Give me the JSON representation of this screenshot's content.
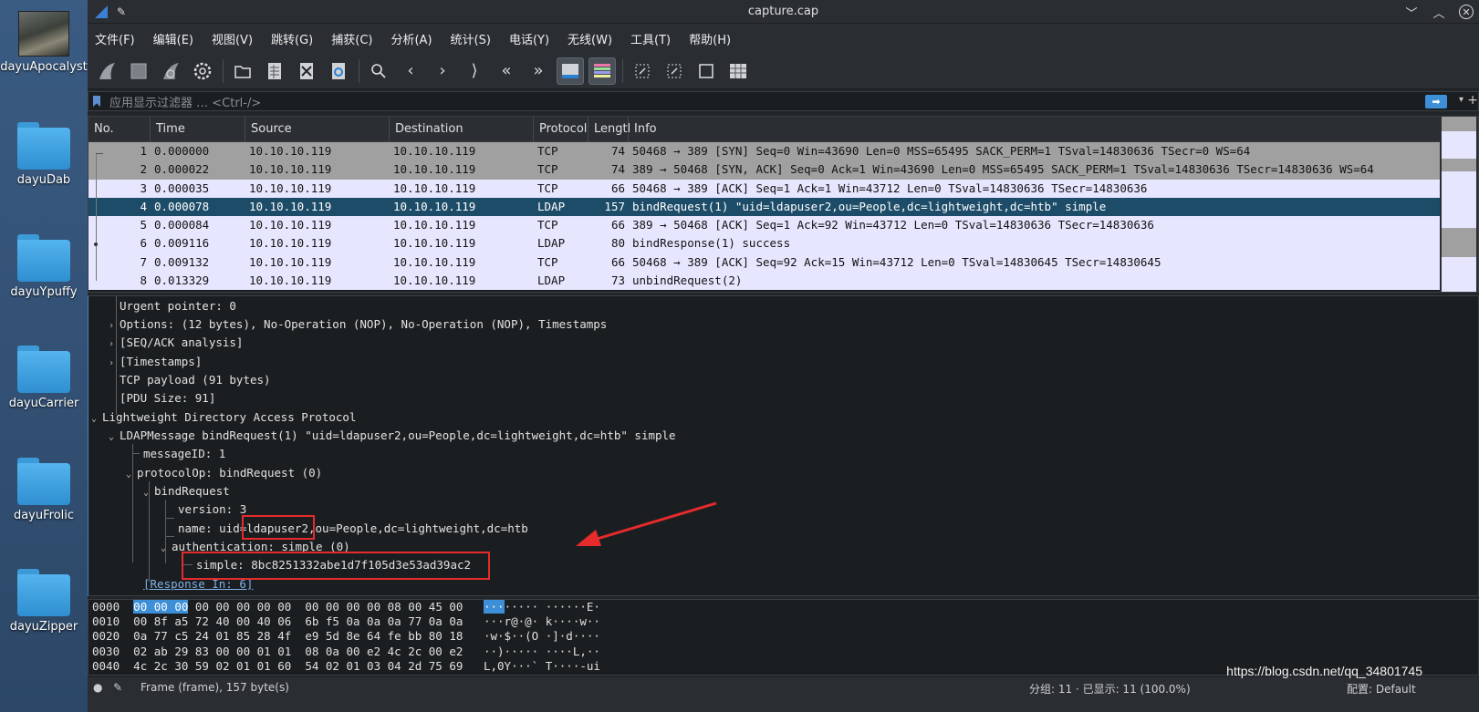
{
  "desktop": {
    "icons": [
      {
        "label": "dayuApocalyst",
        "type": "thumbnail"
      },
      {
        "label": "dayuDab",
        "type": "folder"
      },
      {
        "label": "dayuYpuffy",
        "type": "folder"
      },
      {
        "label": "dayuCarrier",
        "type": "folder"
      },
      {
        "label": "dayuFrolic",
        "type": "folder"
      },
      {
        "label": "dayuZipper",
        "type": "folder"
      }
    ]
  },
  "window": {
    "title": "capture.cap",
    "controls": {
      "minimize": "﹀",
      "maximize": "︿",
      "close": "✕"
    }
  },
  "menu": [
    "文件(F)",
    "编辑(E)",
    "视图(V)",
    "跳转(G)",
    "捕获(C)",
    "分析(A)",
    "统计(S)",
    "电话(Y)",
    "无线(W)",
    "工具(T)",
    "帮助(H)"
  ],
  "toolbar": {
    "icons": [
      "shark-fin-start-icon",
      "stop-square-icon",
      "restart-fin-icon",
      "gear-options-icon",
      "open-folder-icon",
      "file-grid-icon",
      "close-file-icon",
      "reload-file-icon",
      "search-icon",
      "back-arrow-icon",
      "forward-arrow-icon",
      "goto-arrow-icon",
      "first-packet-icon",
      "last-packet-icon",
      "autoscroll-icon",
      "colorize-icon",
      "zoom-in-icon",
      "zoom-out-icon",
      "normal-size-icon",
      "resize-columns-icon"
    ]
  },
  "filter": {
    "placeholder": "应用显示过滤器 … <Ctrl-/>",
    "apply_icon": "arrow-right-icon",
    "dropdown_icon": "chevron-down-icon",
    "add_label": "+"
  },
  "packet_list": {
    "columns": [
      "No.",
      "Time",
      "Source",
      "Destination",
      "Protocol",
      "Lengtl",
      "Info"
    ],
    "rows": [
      {
        "no": "1",
        "time": "0.000000",
        "src": "10.10.10.119",
        "dst": "10.10.10.119",
        "proto": "TCP",
        "len": "74",
        "info": "50468 → 389 [SYN] Seq=0 Win=43690 Len=0 MSS=65495 SACK_PERM=1 TSval=14830636 TSecr=0 WS=64",
        "style": "gray"
      },
      {
        "no": "2",
        "time": "0.000022",
        "src": "10.10.10.119",
        "dst": "10.10.10.119",
        "proto": "TCP",
        "len": "74",
        "info": "389 → 50468 [SYN, ACK] Seq=0 Ack=1 Win=43690 Len=0 MSS=65495 SACK_PERM=1 TSval=14830636 TSecr=14830636 WS=64",
        "style": "gray"
      },
      {
        "no": "3",
        "time": "0.000035",
        "src": "10.10.10.119",
        "dst": "10.10.10.119",
        "proto": "TCP",
        "len": "66",
        "info": "50468 → 389 [ACK] Seq=1 Ack=1 Win=43712 Len=0 TSval=14830636 TSecr=14830636",
        "style": "light"
      },
      {
        "no": "4",
        "time": "0.000078",
        "src": "10.10.10.119",
        "dst": "10.10.10.119",
        "proto": "LDAP",
        "len": "157",
        "info": "bindRequest(1) \"uid=ldapuser2,ou=People,dc=lightweight,dc=htb\" simple",
        "style": "sel"
      },
      {
        "no": "5",
        "time": "0.000084",
        "src": "10.10.10.119",
        "dst": "10.10.10.119",
        "proto": "TCP",
        "len": "66",
        "info": "389 → 50468 [ACK] Seq=1 Ack=92 Win=43712 Len=0 TSval=14830636 TSecr=14830636",
        "style": "light"
      },
      {
        "no": "6",
        "time": "0.009116",
        "src": "10.10.10.119",
        "dst": "10.10.10.119",
        "proto": "LDAP",
        "len": "80",
        "info": "bindResponse(1) success",
        "style": "light"
      },
      {
        "no": "7",
        "time": "0.009132",
        "src": "10.10.10.119",
        "dst": "10.10.10.119",
        "proto": "TCP",
        "len": "66",
        "info": "50468 → 389 [ACK] Seq=92 Ack=15 Win=43712 Len=0 TSval=14830645 TSecr=14830645",
        "style": "light"
      },
      {
        "no": "8",
        "time": "0.013329",
        "src": "10.10.10.119",
        "dst": "10.10.10.119",
        "proto": "LDAP",
        "len": "73",
        "info": "unbindRequest(2)",
        "style": "light"
      }
    ]
  },
  "detail": {
    "lines": [
      {
        "text": "Urgent pointer: 0",
        "caret": ""
      },
      {
        "text": "Options: (12 bytes), No-Operation (NOP), No-Operation (NOP), Timestamps",
        "caret": "›"
      },
      {
        "text": "[SEQ/ACK analysis]",
        "caret": "›"
      },
      {
        "text": "[Timestamps]",
        "caret": "›"
      },
      {
        "text": "TCP payload (91 bytes)",
        "caret": ""
      },
      {
        "text": "[PDU Size: 91]",
        "caret": ""
      },
      {
        "text": "Lightweight Directory Access Protocol",
        "caret": "⌄"
      },
      {
        "text": "LDAPMessage bindRequest(1) \"uid=ldapuser2,ou=People,dc=lightweight,dc=htb\" simple",
        "caret": "⌄"
      },
      {
        "text": "messageID: 1",
        "caret": ""
      },
      {
        "text": "protocolOp: bindRequest (0)",
        "caret": "⌄"
      },
      {
        "text": "bindRequest",
        "caret": "⌄"
      },
      {
        "text": "version: 3",
        "caret": ""
      },
      {
        "text": "name: uid=ldapuser2,ou=People,dc=lightweight,dc=htb",
        "caret": ""
      },
      {
        "text": "authentication: simple (0)",
        "caret": "⌄"
      },
      {
        "text": "simple: 8bc8251332abe1d7f105d3e53ad39ac2",
        "caret": ""
      },
      {
        "text": "[Response In: 6]",
        "caret": ""
      }
    ],
    "annotation_color": "#e52b2b"
  },
  "bytes": {
    "rows": [
      {
        "offset": "0000",
        "sel": "00 00 00",
        "hex": " 00 00 00 00 00  00 00 00 00 08 00 45 00",
        "ascii_sel": "···",
        "ascii": "····· ······E·"
      },
      {
        "offset": "0010",
        "sel": "",
        "hex": "00 8f a5 72 40 00 40 06  6b f5 0a 0a 0a 77 0a 0a",
        "ascii_sel": "",
        "ascii": "···r@·@· k····w··"
      },
      {
        "offset": "0020",
        "sel": "",
        "hex": "0a 77 c5 24 01 85 28 4f  e9 5d 8e 64 fe bb 80 18",
        "ascii_sel": "",
        "ascii": "·w·$··(O ·]·d····"
      },
      {
        "offset": "0030",
        "sel": "",
        "hex": "02 ab 29 83 00 00 01 01  08 0a 00 e2 4c 2c 00 e2",
        "ascii_sel": "",
        "ascii": "··)····· ····L,··"
      },
      {
        "offset": "0040",
        "sel": "",
        "hex": "4c 2c 30 59 02 01 01 60  54 02 01 03 04 2d 75 69",
        "ascii_sel": "",
        "ascii": "L,0Y···` T····-ui"
      }
    ]
  },
  "status": {
    "frame": "Frame (frame), 157 byte(s)",
    "packets": "分组: 11 · 已显示: 11 (100.0%)",
    "profile": "配置: Default"
  },
  "watermark": "https://blog.csdn.net/qq_34801745"
}
